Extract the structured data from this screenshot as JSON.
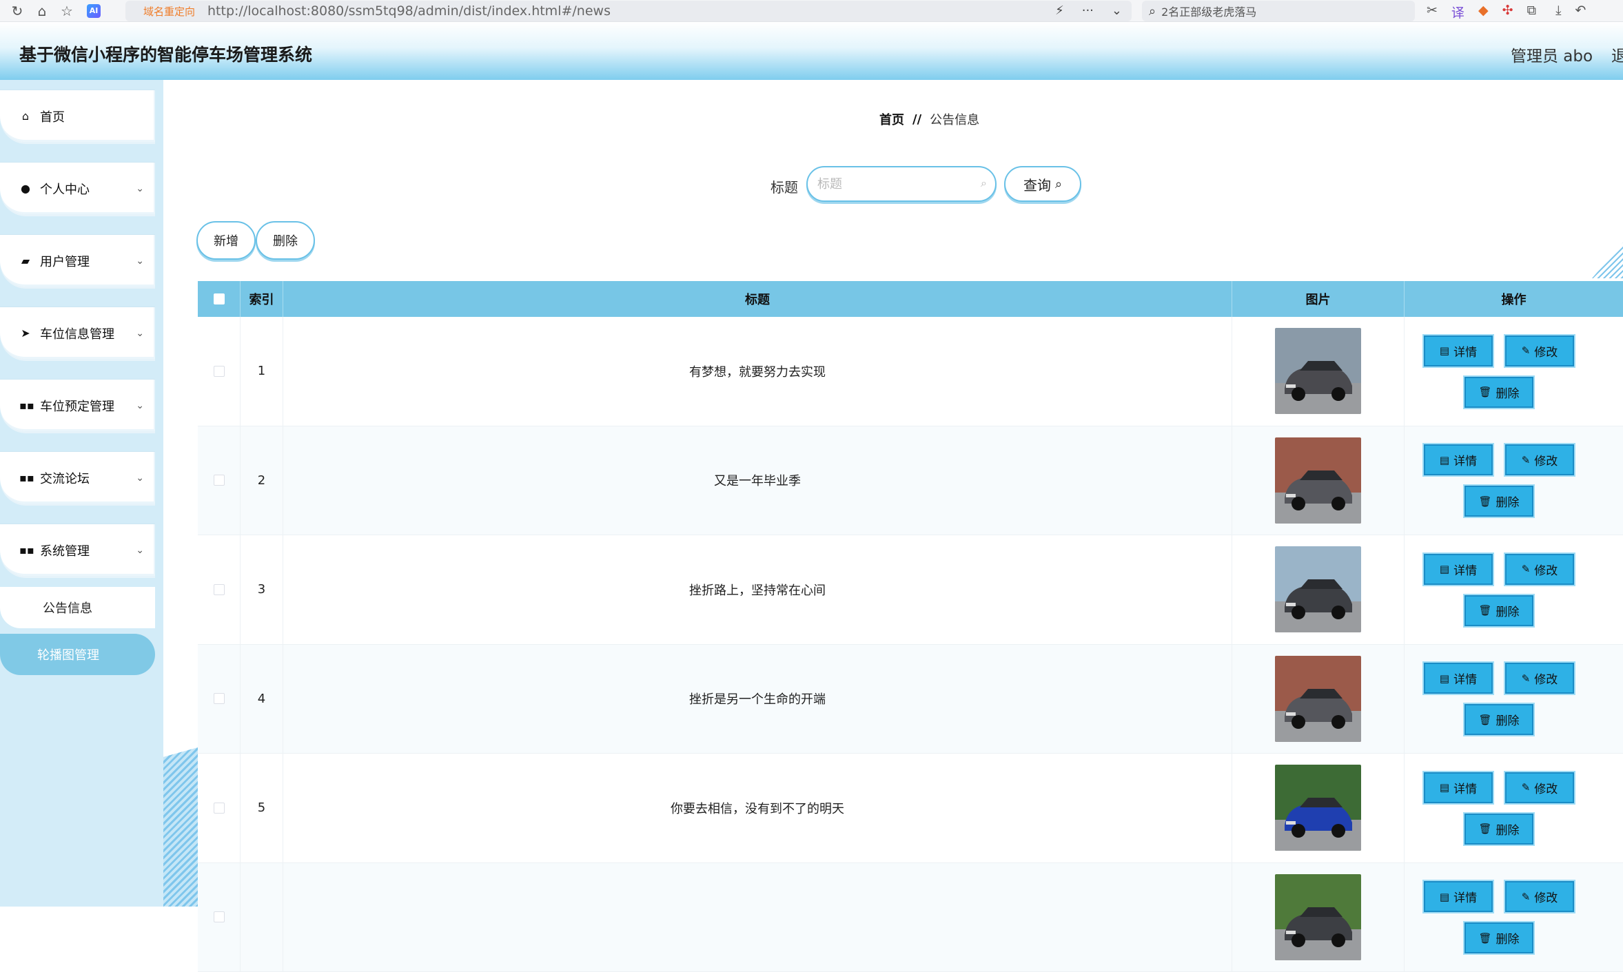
{
  "browser": {
    "redirect_badge": "域名重定向",
    "url": "http://localhost:8080/ssm5tq98/admin/dist/index.html#/news",
    "search_hint": "2名正部级老虎落马"
  },
  "header": {
    "title": "基于微信小程序的智能停车场管理系统",
    "admin": "管理员 abo",
    "logout": "退"
  },
  "sidebar": {
    "items": [
      {
        "label": "首页",
        "icon": "home-icon"
      },
      {
        "label": "个人中心",
        "icon": "user-icon"
      },
      {
        "label": "用户管理",
        "icon": "chart-icon"
      },
      {
        "label": "车位信息管理",
        "icon": "send-icon"
      },
      {
        "label": "车位预定管理",
        "icon": "grid-icon"
      },
      {
        "label": "交流论坛",
        "icon": "grid-icon"
      },
      {
        "label": "系统管理",
        "icon": "grid-icon"
      }
    ],
    "sub_items": [
      {
        "label": "公告信息"
      },
      {
        "label": "轮播图管理"
      }
    ]
  },
  "breadcrumb": {
    "home": "首页",
    "separator": "//",
    "current": "公告信息"
  },
  "search": {
    "label": "标题",
    "placeholder": "标题",
    "button": "查询"
  },
  "actions": {
    "add": "新增",
    "delete": "删除"
  },
  "table": {
    "headers": {
      "index": "索引",
      "title": "标题",
      "image": "图片",
      "ops": "操作"
    },
    "op_labels": {
      "detail": "详情",
      "edit": "修改",
      "delete": "删除"
    },
    "rows": [
      {
        "index": "1",
        "title": "有梦想，就要努力去实现",
        "car_color": "#4a4a4f",
        "bg": "#8a9aa8"
      },
      {
        "index": "2",
        "title": "又是一年毕业季",
        "car_color": "#55565c",
        "bg": "#9b5a4a"
      },
      {
        "index": "3",
        "title": "挫折路上，坚持常在心间",
        "car_color": "#3d3f44",
        "bg": "#9ab4c8"
      },
      {
        "index": "4",
        "title": "挫折是另一个生命的开端",
        "car_color": "#55565c",
        "bg": "#9b5a4a"
      },
      {
        "index": "5",
        "title": "你要去相信，没有到不了的明天",
        "car_color": "#1f3fb0",
        "bg": "#3d6b35"
      },
      {
        "index": "",
        "title": "",
        "car_color": "#3d3f44",
        "bg": "#4f7a3a"
      }
    ]
  },
  "colors": {
    "accent": "#77c6e6",
    "button": "#2eb1e6",
    "sidebar_bg": "#d3ecf8"
  }
}
